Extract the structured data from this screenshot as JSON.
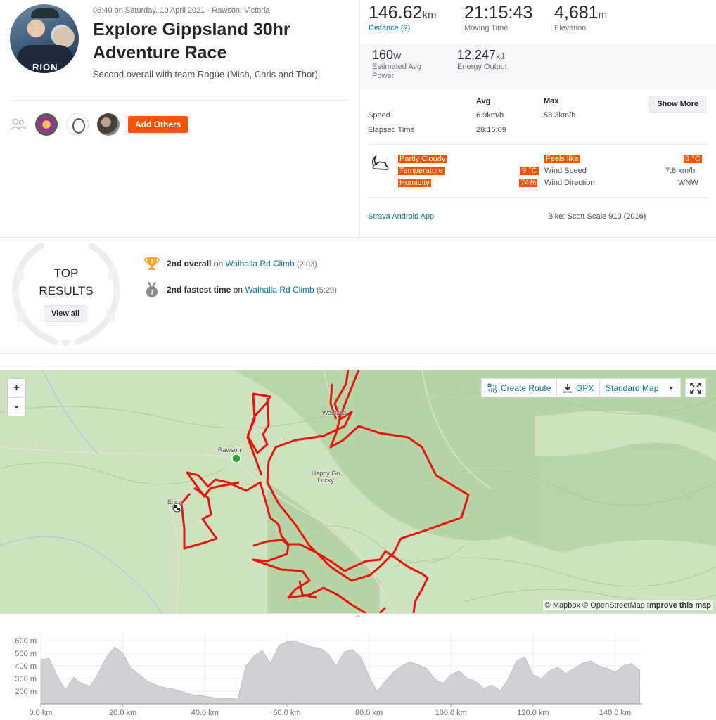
{
  "activity": {
    "datetime": "06:40 on Saturday, 10 April 2021 · Rawson, Victoria",
    "title": "Explore Gippsland 30hr Adventure Race",
    "description": "Second overall with team Rogue (Mish, Chris and Thor).",
    "add_others_label": "Add Others",
    "avatar_text": "RION"
  },
  "stats": {
    "distance": {
      "value": "146.62",
      "unit": "km",
      "label": "Distance (?)"
    },
    "moving_time": {
      "value": "21:15:43",
      "label": "Moving Time"
    },
    "elevation": {
      "value": "4,681",
      "unit": "m",
      "label": "Elevation"
    },
    "power": {
      "value": "160",
      "unit": "W",
      "label_line1": "Estimated Avg",
      "label_line2": "Power"
    },
    "energy": {
      "value": "12,247",
      "unit": "kJ",
      "label": "Energy Output"
    }
  },
  "more_stats": {
    "avg_header": "Avg",
    "max_header": "Max",
    "show_more_label": "Show More",
    "speed_label": "Speed",
    "speed_avg": "6.9km/h",
    "speed_max": "58.3km/h",
    "elapsed_label": "Elapsed Time",
    "elapsed_avg": "28:15:09"
  },
  "weather": {
    "condition": "Partly Cloudy",
    "temperature_label": "Temperature",
    "temperature_value": "9 °C",
    "humidity_label": "Humidity",
    "humidity_value": "74%",
    "feels_like_label": "Feels like",
    "feels_like_value": "8 °C",
    "wind_speed_label": "Wind Speed",
    "wind_speed_value": "7.8 km/h",
    "wind_direction_label": "Wind Direction",
    "wind_direction_value": "WNW"
  },
  "device": "Strava Android App",
  "bike": "Bike: Scott Scale 910 (2016)",
  "top_results": {
    "line1": "TOP",
    "line2": "RESULTS",
    "view_all_label": "View all",
    "achievements": [
      {
        "rank_bold": "2nd overall",
        "on": "on",
        "segment": "Walhalla Rd Climb",
        "time": "(2:03)",
        "medal_number": "2",
        "medal_color": "#f5a623"
      },
      {
        "rank_bold": "2nd fastest time",
        "on": "on",
        "segment": "Walhalla Rd Climb",
        "time": "(5:29)",
        "medal_number": "2",
        "medal_color": "#8a8a8f"
      }
    ]
  },
  "map": {
    "zoom_in": "+",
    "zoom_out": "-",
    "create_route_label": "Create Route",
    "gpx_label": "GPX",
    "map_style_label": "Standard Map",
    "places": [
      "Walhalla",
      "Rawson",
      "Happy Go Lucky",
      "Erica"
    ],
    "attribution_mapbox": "© Mapbox",
    "attribution_osm": "© OpenStreetMap",
    "attribution_improve": "Improve this map",
    "route_color": "#e8140f"
  },
  "chart_data": {
    "type": "area",
    "xlabel": "",
    "ylabel": "",
    "x_ticks": [
      "0.0 km",
      "20.0 km",
      "40.0 km",
      "60.0 km",
      "80.0 km",
      "100.0 km",
      "120.0 km",
      "140.0 km"
    ],
    "y_ticks": [
      "600 m",
      "500 m",
      "400 m",
      "300 m",
      "200 m"
    ],
    "xlim": [
      0,
      146.6
    ],
    "ylim": [
      100,
      600
    ],
    "x": [
      0,
      2,
      4,
      6,
      8,
      10,
      12,
      14,
      16,
      18,
      20,
      22,
      24,
      26,
      28,
      30,
      32,
      34,
      36,
      38,
      40,
      42,
      44,
      46,
      48,
      50,
      52,
      54,
      56,
      58,
      60,
      62,
      64,
      66,
      68,
      70,
      72,
      74,
      76,
      78,
      80,
      82,
      84,
      86,
      88,
      90,
      92,
      94,
      96,
      98,
      100,
      102,
      104,
      106,
      108,
      110,
      112,
      114,
      116,
      118,
      120,
      122,
      124,
      126,
      128,
      130,
      132,
      134,
      136,
      138,
      140,
      142,
      144,
      146
    ],
    "values": [
      450,
      460,
      320,
      210,
      310,
      260,
      240,
      340,
      470,
      550,
      500,
      380,
      330,
      280,
      250,
      230,
      220,
      200,
      180,
      165,
      160,
      150,
      140,
      145,
      135,
      400,
      480,
      520,
      420,
      560,
      590,
      600,
      570,
      550,
      540,
      500,
      400,
      510,
      530,
      470,
      320,
      200,
      280,
      350,
      400,
      430,
      410,
      380,
      300,
      260,
      330,
      360,
      300,
      280,
      220,
      250,
      200,
      300,
      440,
      470,
      330,
      300,
      360,
      390,
      340,
      380,
      420,
      440,
      400,
      380,
      350,
      400,
      420,
      360
    ]
  }
}
